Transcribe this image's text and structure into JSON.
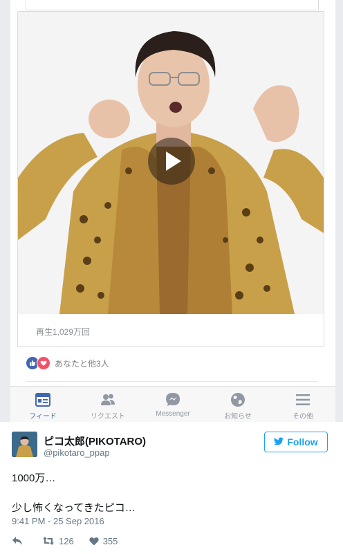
{
  "facebook": {
    "video": {
      "views_text": "再生1,029万回"
    },
    "reactions": {
      "text": "あなたと他3人",
      "like_icon": "like-icon",
      "love_icon": "heart-icon"
    },
    "tabs": [
      {
        "label": "フィード",
        "icon": "news-feed-icon",
        "active": true
      },
      {
        "label": "リクエスト",
        "icon": "friend-requests-icon",
        "active": false
      },
      {
        "label": "Messenger",
        "icon": "messenger-icon",
        "active": false
      },
      {
        "label": "お知らせ",
        "icon": "globe-icon",
        "active": false
      },
      {
        "label": "その他",
        "icon": "menu-icon",
        "active": false
      }
    ],
    "colors": {
      "brand": "#4267b2",
      "love": "#f25268"
    }
  },
  "tweet": {
    "display_name": "ピコ太郎(PIKOTARO)",
    "handle": "@pikotaro_ppap",
    "follow_label": "Follow",
    "text_line1": "1000万…",
    "text_line2": "少し怖くなってきたピコ…",
    "timestamp": "9:41 PM - 25 Sep 2016",
    "retweets": "126",
    "likes": "355",
    "colors": {
      "twitter_blue": "#1da1f2",
      "meta": "#657786"
    }
  }
}
